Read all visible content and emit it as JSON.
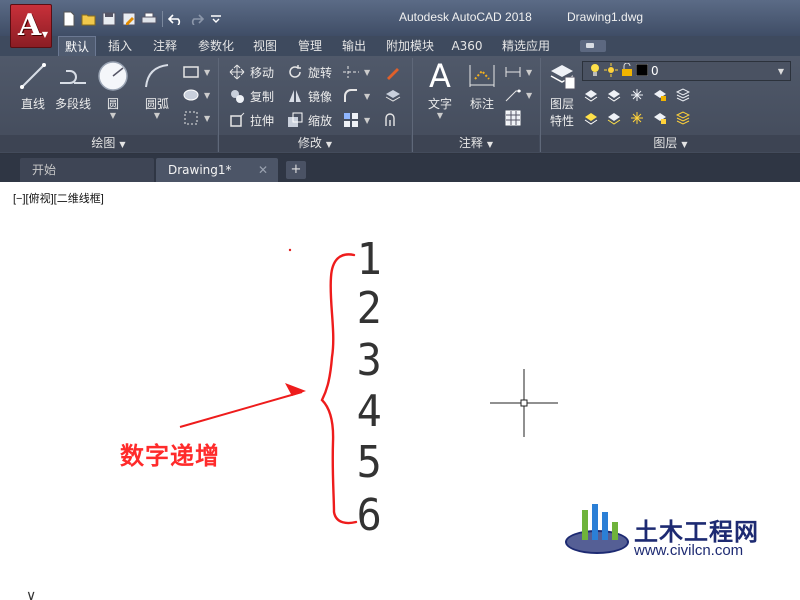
{
  "titlebar": {
    "app_letter": "A",
    "app_name": "Autodesk AutoCAD 2018",
    "file_name": "Drawing1.dwg",
    "qat_icons": [
      "new-icon",
      "open-icon",
      "save-icon",
      "saveas-icon",
      "plot-icon",
      "undo-icon",
      "redo-icon",
      "customize-icon"
    ]
  },
  "ribbon_tabs": [
    "默认",
    "插入",
    "注释",
    "参数化",
    "视图",
    "管理",
    "输出",
    "附加模块",
    "A360",
    "精选应用"
  ],
  "panels": {
    "draw": {
      "title": "绘图",
      "line": "直线",
      "polyline": "多段线",
      "circle": "圆",
      "arc": "圆弧"
    },
    "modify": {
      "title": "修改",
      "move": "移动",
      "rotate": "旋转",
      "copy": "复制",
      "mirror": "镜像",
      "stretch": "拉伸",
      "scale": "缩放"
    },
    "annotation": {
      "title": "注释",
      "text": "文字",
      "dimension": "标注"
    },
    "layers": {
      "title": "图层",
      "properties_line1": "图层",
      "properties_line2": "特性",
      "current_layer": "0"
    }
  },
  "file_tabs": {
    "start": "开始",
    "drawing": "Drawing1*",
    "close": "✕",
    "new": "+"
  },
  "canvas": {
    "viewport_label": "[−][俯视][二维线框]",
    "digits": [
      "1",
      "2",
      "3",
      "4",
      "5",
      "6"
    ],
    "annotation": "数字递增",
    "watermark_cn": "土木工程网",
    "watermark_url": "www.civilcn.com",
    "ucs_glyph": "∨"
  },
  "colors": {
    "ribbon_bg": "#4a5262",
    "annotation_red": "#ff2b2b",
    "watermark_blue": "#1d2a72"
  }
}
